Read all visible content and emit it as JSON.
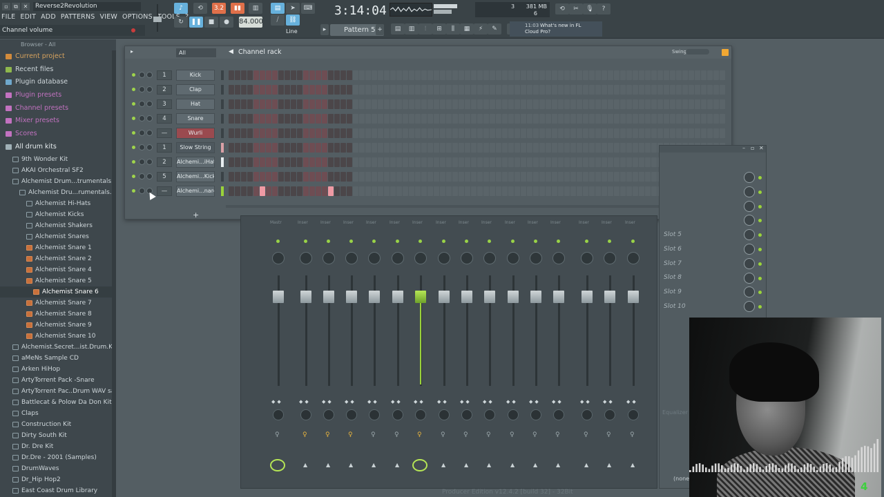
{
  "window": {
    "title": "Reverse2Revolution",
    "buttons": [
      "▫",
      "⧉",
      "✕"
    ]
  },
  "menu": [
    "FILE",
    "EDIT",
    "ADD",
    "PATTERNS",
    "VIEW",
    "OPTIONS",
    "TOOLS",
    "?"
  ],
  "hint": "Channel volume",
  "transport": {
    "time": "3:14:04",
    "tempo": "84.000",
    "pattern": "Pattern 5",
    "snap": "Line",
    "memory": "381 MB",
    "voices": "6",
    "cpu": "3"
  },
  "news": {
    "time": "11:03",
    "title": "What's new in FL",
    "subtitle": "Cloud Pro?"
  },
  "browser": {
    "header": "Browser - All",
    "top_items": [
      {
        "label": "Current project",
        "icon_color": "#d28b3c"
      },
      {
        "label": "Recent files",
        "icon_color": "#8fb84d"
      },
      {
        "label": "Plugin database",
        "icon_color": "#6fa8cc"
      },
      {
        "label": "Plugin presets",
        "icon_color": "#c272c0"
      },
      {
        "label": "Channel presets",
        "icon_color": "#c272c0"
      },
      {
        "label": "Mixer presets",
        "icon_color": "#c272c0"
      },
      {
        "label": "Scores",
        "icon_color": "#c272c0"
      },
      {
        "label": "All drum kits",
        "icon_color": "#a0b0b6"
      }
    ],
    "tree": [
      {
        "label": "9th Wonder Kit",
        "indent": 1,
        "type": "folder"
      },
      {
        "label": "AKAI Orchestral SF2",
        "indent": 1,
        "type": "folder"
      },
      {
        "label": "Alchemist Drum...trumentals.com)",
        "indent": 1,
        "type": "folder"
      },
      {
        "label": "Alchemist Dru...rumentals.com)",
        "indent": 2,
        "type": "folder"
      },
      {
        "label": "Alchemist Hi-Hats",
        "indent": 3,
        "type": "folder"
      },
      {
        "label": "Alchemist Kicks",
        "indent": 3,
        "type": "folder"
      },
      {
        "label": "Alchemist Shakers",
        "indent": 3,
        "type": "folder"
      },
      {
        "label": "Alchemist Snares",
        "indent": 3,
        "type": "folder"
      },
      {
        "label": "Alchemist Snare 1",
        "indent": 3,
        "type": "file"
      },
      {
        "label": "Alchemist Snare 2",
        "indent": 3,
        "type": "file"
      },
      {
        "label": "Alchemist Snare 4",
        "indent": 3,
        "type": "file"
      },
      {
        "label": "Alchemist Snare 5",
        "indent": 3,
        "type": "file"
      },
      {
        "label": "Alchemist Snare 6",
        "indent": 4,
        "type": "file",
        "selected": true
      },
      {
        "label": "Alchemist Snare 7",
        "indent": 3,
        "type": "file"
      },
      {
        "label": "Alchemist Snare 8",
        "indent": 3,
        "type": "file"
      },
      {
        "label": "Alchemist Snare 9",
        "indent": 3,
        "type": "file"
      },
      {
        "label": "Alchemist Snare 10",
        "indent": 3,
        "type": "file"
      },
      {
        "label": "Alchemist.Secret...ist.Drum.Kit).WAV",
        "indent": 1,
        "type": "folder"
      },
      {
        "label": "aMeNs Sample CD",
        "indent": 1,
        "type": "folder"
      },
      {
        "label": "Arken HiHop",
        "indent": 1,
        "type": "folder"
      },
      {
        "label": "ArtyTorrent Pack -Snare",
        "indent": 1,
        "type": "folder"
      },
      {
        "label": "ArtyTorrent Pac..Drum WAV samples",
        "indent": 1,
        "type": "folder"
      },
      {
        "label": "Battlecat & Polow Da Don Kit",
        "indent": 1,
        "type": "folder"
      },
      {
        "label": "Claps",
        "indent": 1,
        "type": "folder"
      },
      {
        "label": "Construction Kit",
        "indent": 1,
        "type": "folder"
      },
      {
        "label": "Dirty South Kit",
        "indent": 1,
        "type": "folder"
      },
      {
        "label": "Dr. Dre Kit",
        "indent": 1,
        "type": "folder"
      },
      {
        "label": "Dr.Dre - 2001 (Samples)",
        "indent": 1,
        "type": "folder"
      },
      {
        "label": "DrumWaves",
        "indent": 1,
        "type": "folder"
      },
      {
        "label": "Dr_Hip Hop2",
        "indent": 1,
        "type": "folder"
      },
      {
        "label": "East Coast Drum Library",
        "indent": 1,
        "type": "folder"
      }
    ]
  },
  "rack": {
    "filter": "All",
    "title": "Channel rack",
    "swing_label": "Swing",
    "add_label": "+",
    "channels": [
      {
        "num": "1",
        "name": "Kick",
        "style": "normal",
        "steps_on": []
      },
      {
        "num": "2",
        "name": "Clap",
        "style": "normal",
        "steps_on": []
      },
      {
        "num": "3",
        "name": "Hat",
        "style": "normal",
        "steps_on": []
      },
      {
        "num": "4",
        "name": "Snare",
        "style": "normal",
        "steps_on": []
      },
      {
        "num": "—",
        "name": "Wurli",
        "style": "red",
        "steps_on": []
      },
      {
        "num": "1",
        "name": "Slow String",
        "style": "dark",
        "steps_on": []
      },
      {
        "num": "2",
        "name": "Alchemi...iHat 9",
        "style": "normal",
        "steps_on": []
      },
      {
        "num": "5",
        "name": "Alchemi...Kick 8",
        "style": "normal",
        "steps_on": []
      },
      {
        "num": "—",
        "name": "Alchemi...nare 6",
        "style": "normal",
        "steps_on": [
          5,
          16
        ]
      }
    ]
  },
  "mixer": {
    "strips": [
      "Mastr",
      "Inser",
      "Inser",
      "Inser",
      "Inser",
      "Inser",
      "Inser",
      "Inser",
      "Inser",
      "Inser",
      "Inser",
      "Inser",
      "Inser",
      "Inser",
      "Inser",
      "Inser",
      "Inser"
    ],
    "active_strip": 6,
    "slots": [
      "Slot 5",
      "Slot 6",
      "Slot 7",
      "Slot 8",
      "Slot 9",
      "Slot 10"
    ],
    "eq_label": "Equalizer",
    "output_label": "(none)"
  },
  "footer_watermark": "Producer Edition v12.4.2 [build 32] - 32Bit",
  "webcam_badge": "4",
  "colors": {
    "accent_green": "#9ad33a",
    "accent_blue": "#67b1dc",
    "step_on": "#ef9aa4"
  }
}
